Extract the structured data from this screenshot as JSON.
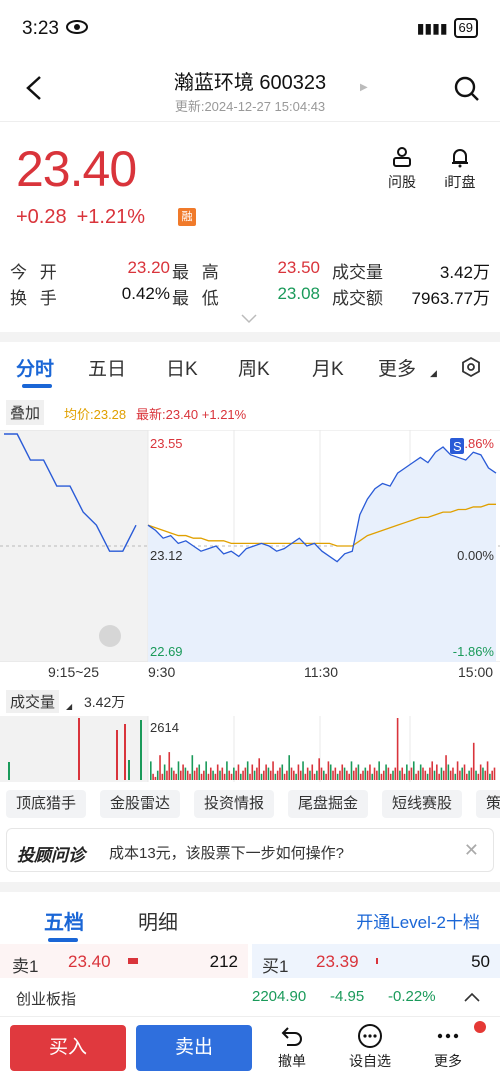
{
  "status": {
    "time": "3:23",
    "battery": "69"
  },
  "header": {
    "title": "瀚蓝环境 600323",
    "updated": "更新:2024-12-27 15:04:43"
  },
  "quote": {
    "price": "23.40",
    "change": "+0.28",
    "change_pct": "+1.21%",
    "badge": "融",
    "ask_label": "问股",
    "watch_label": "i盯盘"
  },
  "stats": {
    "open_label": "今  开",
    "open": "23.20",
    "high_label": "最  高",
    "high": "23.50",
    "volume_label": "成交量",
    "volume": "3.42万",
    "turnover_label": "换  手",
    "turnover": "0.42%",
    "low_label": "最  低",
    "low": "23.08",
    "amount_label": "成交额",
    "amount": "7963.77万"
  },
  "tabs": [
    "分时",
    "五日",
    "日K",
    "周K",
    "月K",
    "更多"
  ],
  "overlay": {
    "label": "叠加",
    "avg": "均价:23.28",
    "last": "最新:23.40 +1.21%"
  },
  "chart_data": {
    "type": "line",
    "y_left_labels": [
      "23.55",
      "23.12",
      "22.69"
    ],
    "y_right_labels": [
      "1.86%",
      "0.00%",
      "-1.86%"
    ],
    "ylim": [
      22.69,
      23.55
    ],
    "preclose": 23.12,
    "x_labels": [
      "9:15~25",
      "9:30",
      "11:30",
      "15:00"
    ],
    "series": [
      {
        "name": "最新",
        "color": "#2a5bd7",
        "values": [
          23.2,
          23.18,
          23.15,
          23.16,
          23.13,
          23.14,
          23.12,
          23.1,
          23.11,
          23.12,
          23.09,
          23.1,
          23.08,
          23.11,
          23.12,
          23.13,
          23.12,
          23.1,
          23.11,
          23.13,
          23.15,
          23.12,
          23.13,
          23.1,
          23.08,
          23.06,
          23.09,
          23.1,
          23.24,
          23.3,
          23.34,
          23.36,
          23.35,
          23.4,
          23.42,
          23.44,
          23.46,
          23.44,
          23.48,
          23.5,
          23.47,
          23.46,
          23.45,
          23.48,
          23.47,
          23.42,
          23.4
        ]
      },
      {
        "name": "均价",
        "color": "#e0a000",
        "values": [
          23.2,
          23.19,
          23.18,
          23.17,
          23.16,
          23.16,
          23.15,
          23.15,
          23.14,
          23.14,
          23.14,
          23.13,
          23.13,
          23.13,
          23.13,
          23.13,
          23.13,
          23.13,
          23.13,
          23.13,
          23.13,
          23.13,
          23.13,
          23.13,
          23.13,
          23.12,
          23.12,
          23.12,
          23.14,
          23.16,
          23.17,
          23.18,
          23.19,
          23.2,
          23.21,
          23.22,
          23.23,
          23.23,
          23.24,
          23.25,
          23.25,
          23.26,
          23.26,
          23.27,
          23.27,
          23.28,
          23.28
        ]
      }
    ],
    "auction": {
      "values": [
        23.55,
        23.55,
        23.45,
        23.45,
        23.35,
        23.35,
        23.25,
        23.2,
        23.1,
        23.1,
        23.2
      ]
    }
  },
  "volume": {
    "label": "成交量",
    "value": "3.42万",
    "max_label": "2614",
    "bars": [
      6,
      2,
      1,
      3,
      8,
      2,
      5,
      3,
      9,
      4,
      3,
      2,
      6,
      3,
      5,
      4,
      3,
      2,
      8,
      3,
      4,
      5,
      2,
      3,
      6,
      2,
      4,
      3,
      2,
      5,
      3,
      4,
      2,
      6,
      3,
      2,
      4,
      3,
      5,
      2,
      3,
      4,
      6,
      2,
      5,
      3,
      4,
      7,
      2,
      3,
      5,
      4,
      3,
      6,
      2,
      3,
      4,
      5,
      2,
      3,
      8,
      4,
      3,
      2,
      5,
      3,
      6,
      2,
      4,
      3,
      5,
      2,
      3,
      7,
      4,
      3,
      2,
      6,
      5,
      3,
      4,
      2,
      3,
      5,
      4,
      3,
      2,
      6,
      3,
      4,
      5,
      2,
      3,
      4,
      3,
      5,
      2,
      4,
      3,
      6,
      2,
      3,
      5,
      4,
      2,
      3,
      4,
      20,
      3,
      4,
      2,
      5,
      3,
      4,
      6,
      2,
      3,
      5,
      4,
      3,
      2,
      4,
      6,
      3,
      5,
      2,
      4,
      3,
      8,
      5,
      3,
      4,
      2,
      6,
      3,
      4,
      5,
      2,
      3,
      4,
      12,
      3,
      2,
      5,
      4,
      3,
      6,
      2,
      3,
      4
    ]
  },
  "chips": [
    "顶底猎手",
    "金股雷达",
    "投资情报",
    "尾盘掘金",
    "短线赛股",
    "策"
  ],
  "ask": {
    "brand": "投顾问诊",
    "question": "成本13元，该股票下一步如何操作?"
  },
  "orderbook": {
    "tab1": "五档",
    "tab2": "明细",
    "level2": "开通Level-2十档",
    "sell_label": "卖1",
    "sell_price": "23.40",
    "sell_qty": "212",
    "buy_label": "买1",
    "buy_price": "23.39",
    "buy_qty": "50"
  },
  "index": {
    "name": "创业板指",
    "value": "2204.90",
    "change": "-4.95",
    "pct": "-0.22%"
  },
  "bottom": {
    "buy": "买入",
    "sell": "卖出",
    "cancel": "撤单",
    "watchlist": "设自选",
    "more": "更多"
  }
}
